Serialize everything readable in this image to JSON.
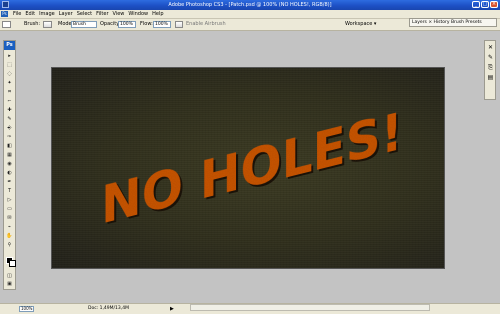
{
  "window": {
    "title": "Adobe Photoshop CS3 - [Patch.psd @ 100% (NO HOLES!, RGB/8)]"
  },
  "menubar": {
    "app_icon": "Ps",
    "items": [
      "File",
      "Edit",
      "Image",
      "Layer",
      "Select",
      "Filter",
      "View",
      "Window",
      "Help"
    ]
  },
  "options": {
    "brush_label": "Brush:",
    "mode_label": "Mode:",
    "mode_value": "Brush",
    "opacity_label": "Opacity:",
    "opacity_value": "100%",
    "flow_label": "Flow:",
    "flow_value": "100%",
    "airbrush_label": "Enable Airbrush",
    "workspace_label": "Workspace ▾"
  },
  "layers_mini": {
    "text": "Layers × History Brush Presets"
  },
  "toolbox": {
    "logo": "Ps",
    "tools": [
      "move-icon",
      "marquee-icon",
      "lasso-icon",
      "magic-wand-icon",
      "crop-icon",
      "slice-icon",
      "healing-icon",
      "brush-icon",
      "clone-stamp-icon",
      "history-brush-icon",
      "eraser-icon",
      "gradient-icon",
      "blur-icon",
      "dodge-icon",
      "pen-icon",
      "type-icon",
      "path-select-icon",
      "shape-icon",
      "notes-icon",
      "eyedropper-icon",
      "hand-icon",
      "zoom-icon"
    ],
    "glyphs": [
      "▸",
      "⬚",
      "◌",
      "✦",
      "⌗",
      "⌐",
      "✚",
      "✎",
      "⎆",
      "✑",
      "◧",
      "▦",
      "◉",
      "◐",
      "✒",
      "T",
      "▷",
      "▭",
      "✉",
      "⌁",
      "✋",
      "⚲"
    ]
  },
  "canvas": {
    "text": "NO HOLES!",
    "text_color": "#d25a10",
    "bg_color": "#2f2e1c"
  },
  "status": {
    "zoom": "100%",
    "doc_size": "Doc: 1,49M/13,4M",
    "arrow": "▶"
  },
  "colors": {
    "title_bar": "#1c4fc4",
    "chrome": "#ece9d8",
    "workspace_bg": "#c3c3c3"
  }
}
